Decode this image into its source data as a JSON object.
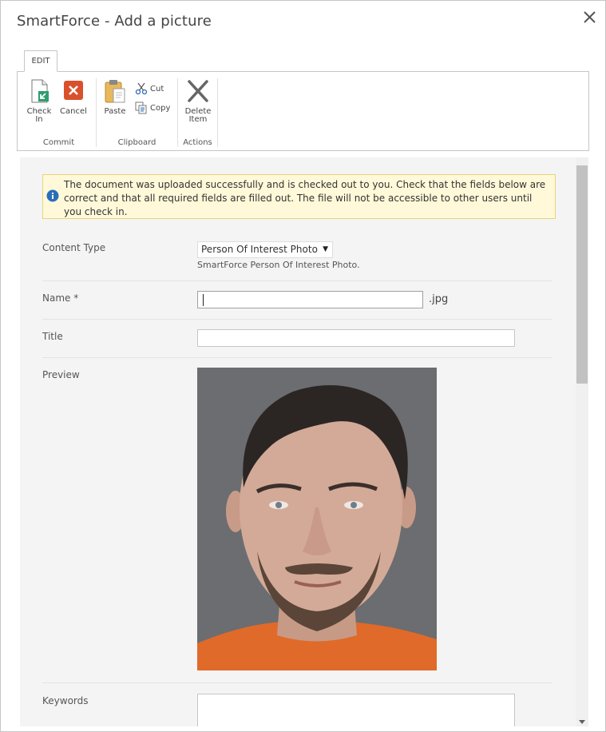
{
  "dialog": {
    "title": "SmartForce - Add a picture",
    "close_icon": "close-icon"
  },
  "ribbon": {
    "tab_label": "EDIT",
    "groups": {
      "commit": {
        "label": "Commit",
        "check_in_line1": "Check",
        "check_in_line2": "In",
        "cancel_label": "Cancel"
      },
      "clipboard": {
        "label": "Clipboard",
        "paste_label": "Paste",
        "cut_label": "Cut",
        "copy_label": "Copy"
      },
      "actions": {
        "label": "Actions",
        "delete_line1": "Delete",
        "delete_line2": "Item"
      }
    }
  },
  "notice": {
    "text": "The document was uploaded successfully and is checked out to you. Check that the fields below are correct and that all required fields are filled out. The file will not be accessible to other users until you check in.",
    "icon": "info-icon"
  },
  "form": {
    "content_type_label": "Content Type",
    "content_type_value": "Person Of Interest Photo",
    "content_type_desc": "SmartForce Person Of Interest Photo.",
    "name_label": "Name *",
    "name_value": "",
    "name_ext": ".jpg",
    "title_label": "Title",
    "title_value": "",
    "preview_label": "Preview",
    "keywords_label": "Keywords",
    "keywords_value": ""
  },
  "colors": {
    "notice_bg": "#fff9d9",
    "notice_border": "#e6d57a",
    "accent_blue": "#2a6ebb",
    "cancel_red": "#d9502c"
  }
}
